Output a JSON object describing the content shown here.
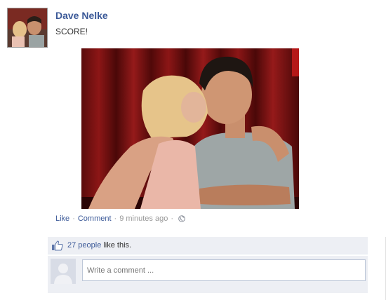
{
  "post": {
    "author": "Dave Nelke",
    "status_text": "SCORE!",
    "actions": {
      "like_label": "Like",
      "comment_label": "Comment",
      "separator": "·",
      "timestamp": "9 minutes ago",
      "privacy_icon": "globe-icon"
    }
  },
  "ufi": {
    "likes_link": "27 people",
    "likes_suffix": "like this.",
    "like_icon": "thumbs-up-icon",
    "comment_placeholder": "Write a comment ..."
  },
  "colors": {
    "link": "#3b5998",
    "ufi_background": "#edeff4",
    "input_border": "#bdc7d8",
    "meta_text": "#999999"
  }
}
